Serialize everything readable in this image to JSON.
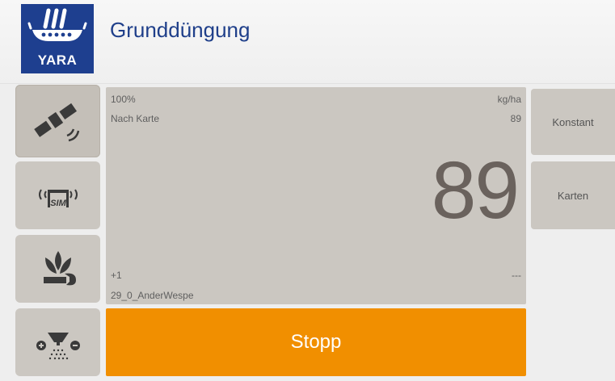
{
  "header": {
    "brand": "YARA",
    "title": "Grunddüngung"
  },
  "sidebar": {
    "items": [
      {
        "icon": "satellite-icon",
        "active": true
      },
      {
        "icon": "sim-icon",
        "label": "SIM"
      },
      {
        "icon": "plant-wrench-icon"
      },
      {
        "icon": "spreader-icon"
      }
    ]
  },
  "main": {
    "percent": "100%",
    "unit": "kg/ha",
    "mode_label": "Nach Karte",
    "small_value": "89",
    "big_value": "89",
    "offset": "+1",
    "offset_value": "---",
    "map_name": "29_0_AnderWespe"
  },
  "right": {
    "constant_label": "Konstant",
    "maps_label": "Karten"
  },
  "stop_label": "Stopp",
  "colors": {
    "brand_blue": "#1e3f8f",
    "title_blue": "#1f3f8a",
    "panel_gray": "#cbc7c1",
    "stop_orange": "#f18f00"
  }
}
